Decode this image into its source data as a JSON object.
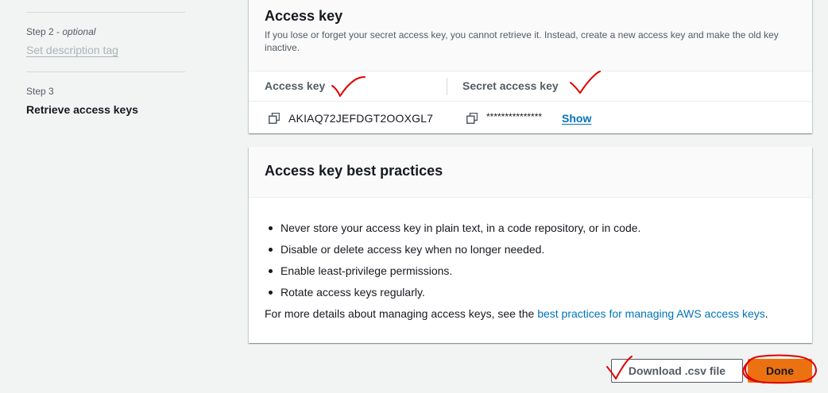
{
  "steps": {
    "step2_caption": "Step 2",
    "step2_optional": "optional",
    "step2_title": "Set description tag",
    "step3_caption": "Step 3",
    "step3_title": "Retrieve access keys"
  },
  "access_key_card": {
    "title": "Access key",
    "description": "If you lose or forget your secret access key, you cannot retrieve it. Instead, create a new access key and make the old key inactive.",
    "col_access_key": "Access key",
    "col_secret_key": "Secret access key",
    "access_key_value": "AKIAQ72JEFDGT2OOXGL7",
    "secret_key_masked": "***************",
    "show_label": "Show"
  },
  "best_practices_card": {
    "title": "Access key best practices",
    "items": [
      "Never store your access key in plain text, in a code repository, or in code.",
      "Disable or delete access key when no longer needed.",
      "Enable least-privilege permissions.",
      "Rotate access keys regularly."
    ],
    "footer_prefix": "For more details about managing access keys, see the ",
    "footer_link": "best practices for managing AWS access keys",
    "footer_suffix": "."
  },
  "buttons": {
    "download_csv": "Download .csv file",
    "done": "Done"
  },
  "colors": {
    "link": "#0073bb",
    "primary_button": "#ec7211",
    "annotation": "#e00000"
  },
  "icons": {
    "copy": "copy-icon"
  }
}
